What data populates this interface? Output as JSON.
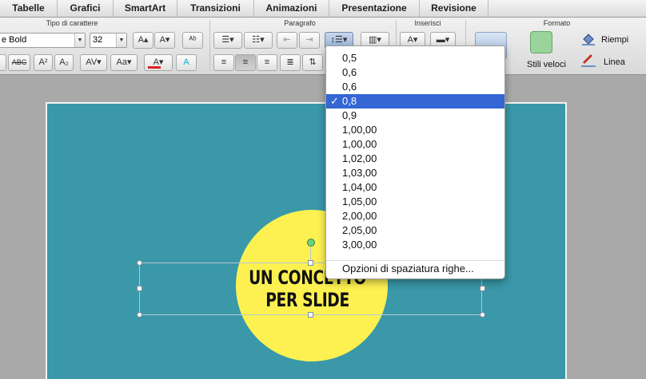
{
  "tabs": [
    "Tabelle",
    "Grafici",
    "SmartArt",
    "Transizioni",
    "Animazioni",
    "Presentazione",
    "Revisione"
  ],
  "groups": {
    "font": "Tipo di carattere",
    "paragraph": "Paragrafo",
    "insert": "Inserisci",
    "format": "Formato"
  },
  "font": {
    "name": "e Bold",
    "size": "32"
  },
  "format_labels": {
    "quick_styles": "Stili veloci",
    "fill": "Riempi",
    "line": "Linea"
  },
  "line_spacing_menu": {
    "items": [
      "0,5",
      "0,6",
      "0,6",
      "0,8",
      "0,9",
      "1,00,00",
      "1,00,00",
      "1,02,00",
      "1,03,00",
      "1,04,00",
      "1,05,00",
      "2,00,00",
      "2,05,00",
      "3,00,00"
    ],
    "selected_index": 3,
    "check_mark": "✓",
    "options_label": "Opzioni di spaziatura righe..."
  },
  "slide": {
    "line1": "UN CONCETTO",
    "line2": "PER SLIDE"
  },
  "colors": {
    "slide_bg": "#3a98a9",
    "circle": "#fdf152",
    "menu_highlight": "#3466d4",
    "font_color_bar": "#e02020",
    "fill_swatch": "#9ad49a"
  }
}
